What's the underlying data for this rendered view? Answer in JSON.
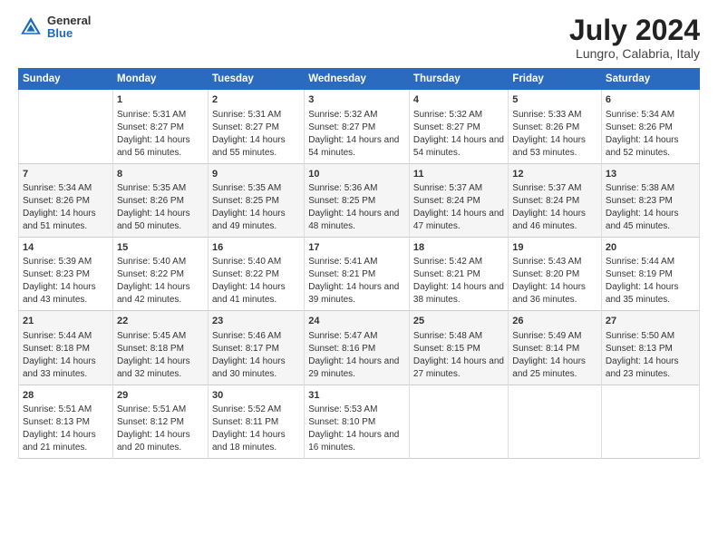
{
  "header": {
    "logo_general": "General",
    "logo_blue": "Blue",
    "title": "July 2024",
    "subtitle": "Lungro, Calabria, Italy"
  },
  "calendar": {
    "days_of_week": [
      "Sunday",
      "Monday",
      "Tuesday",
      "Wednesday",
      "Thursday",
      "Friday",
      "Saturday"
    ],
    "weeks": [
      [
        {
          "day": "",
          "sunrise": "",
          "sunset": "",
          "daylight": ""
        },
        {
          "day": "1",
          "sunrise": "Sunrise: 5:31 AM",
          "sunset": "Sunset: 8:27 PM",
          "daylight": "Daylight: 14 hours and 56 minutes."
        },
        {
          "day": "2",
          "sunrise": "Sunrise: 5:31 AM",
          "sunset": "Sunset: 8:27 PM",
          "daylight": "Daylight: 14 hours and 55 minutes."
        },
        {
          "day": "3",
          "sunrise": "Sunrise: 5:32 AM",
          "sunset": "Sunset: 8:27 PM",
          "daylight": "Daylight: 14 hours and 54 minutes."
        },
        {
          "day": "4",
          "sunrise": "Sunrise: 5:32 AM",
          "sunset": "Sunset: 8:27 PM",
          "daylight": "Daylight: 14 hours and 54 minutes."
        },
        {
          "day": "5",
          "sunrise": "Sunrise: 5:33 AM",
          "sunset": "Sunset: 8:26 PM",
          "daylight": "Daylight: 14 hours and 53 minutes."
        },
        {
          "day": "6",
          "sunrise": "Sunrise: 5:34 AM",
          "sunset": "Sunset: 8:26 PM",
          "daylight": "Daylight: 14 hours and 52 minutes."
        }
      ],
      [
        {
          "day": "7",
          "sunrise": "Sunrise: 5:34 AM",
          "sunset": "Sunset: 8:26 PM",
          "daylight": "Daylight: 14 hours and 51 minutes."
        },
        {
          "day": "8",
          "sunrise": "Sunrise: 5:35 AM",
          "sunset": "Sunset: 8:26 PM",
          "daylight": "Daylight: 14 hours and 50 minutes."
        },
        {
          "day": "9",
          "sunrise": "Sunrise: 5:35 AM",
          "sunset": "Sunset: 8:25 PM",
          "daylight": "Daylight: 14 hours and 49 minutes."
        },
        {
          "day": "10",
          "sunrise": "Sunrise: 5:36 AM",
          "sunset": "Sunset: 8:25 PM",
          "daylight": "Daylight: 14 hours and 48 minutes."
        },
        {
          "day": "11",
          "sunrise": "Sunrise: 5:37 AM",
          "sunset": "Sunset: 8:24 PM",
          "daylight": "Daylight: 14 hours and 47 minutes."
        },
        {
          "day": "12",
          "sunrise": "Sunrise: 5:37 AM",
          "sunset": "Sunset: 8:24 PM",
          "daylight": "Daylight: 14 hours and 46 minutes."
        },
        {
          "day": "13",
          "sunrise": "Sunrise: 5:38 AM",
          "sunset": "Sunset: 8:23 PM",
          "daylight": "Daylight: 14 hours and 45 minutes."
        }
      ],
      [
        {
          "day": "14",
          "sunrise": "Sunrise: 5:39 AM",
          "sunset": "Sunset: 8:23 PM",
          "daylight": "Daylight: 14 hours and 43 minutes."
        },
        {
          "day": "15",
          "sunrise": "Sunrise: 5:40 AM",
          "sunset": "Sunset: 8:22 PM",
          "daylight": "Daylight: 14 hours and 42 minutes."
        },
        {
          "day": "16",
          "sunrise": "Sunrise: 5:40 AM",
          "sunset": "Sunset: 8:22 PM",
          "daylight": "Daylight: 14 hours and 41 minutes."
        },
        {
          "day": "17",
          "sunrise": "Sunrise: 5:41 AM",
          "sunset": "Sunset: 8:21 PM",
          "daylight": "Daylight: 14 hours and 39 minutes."
        },
        {
          "day": "18",
          "sunrise": "Sunrise: 5:42 AM",
          "sunset": "Sunset: 8:21 PM",
          "daylight": "Daylight: 14 hours and 38 minutes."
        },
        {
          "day": "19",
          "sunrise": "Sunrise: 5:43 AM",
          "sunset": "Sunset: 8:20 PM",
          "daylight": "Daylight: 14 hours and 36 minutes."
        },
        {
          "day": "20",
          "sunrise": "Sunrise: 5:44 AM",
          "sunset": "Sunset: 8:19 PM",
          "daylight": "Daylight: 14 hours and 35 minutes."
        }
      ],
      [
        {
          "day": "21",
          "sunrise": "Sunrise: 5:44 AM",
          "sunset": "Sunset: 8:18 PM",
          "daylight": "Daylight: 14 hours and 33 minutes."
        },
        {
          "day": "22",
          "sunrise": "Sunrise: 5:45 AM",
          "sunset": "Sunset: 8:18 PM",
          "daylight": "Daylight: 14 hours and 32 minutes."
        },
        {
          "day": "23",
          "sunrise": "Sunrise: 5:46 AM",
          "sunset": "Sunset: 8:17 PM",
          "daylight": "Daylight: 14 hours and 30 minutes."
        },
        {
          "day": "24",
          "sunrise": "Sunrise: 5:47 AM",
          "sunset": "Sunset: 8:16 PM",
          "daylight": "Daylight: 14 hours and 29 minutes."
        },
        {
          "day": "25",
          "sunrise": "Sunrise: 5:48 AM",
          "sunset": "Sunset: 8:15 PM",
          "daylight": "Daylight: 14 hours and 27 minutes."
        },
        {
          "day": "26",
          "sunrise": "Sunrise: 5:49 AM",
          "sunset": "Sunset: 8:14 PM",
          "daylight": "Daylight: 14 hours and 25 minutes."
        },
        {
          "day": "27",
          "sunrise": "Sunrise: 5:50 AM",
          "sunset": "Sunset: 8:13 PM",
          "daylight": "Daylight: 14 hours and 23 minutes."
        }
      ],
      [
        {
          "day": "28",
          "sunrise": "Sunrise: 5:51 AM",
          "sunset": "Sunset: 8:13 PM",
          "daylight": "Daylight: 14 hours and 21 minutes."
        },
        {
          "day": "29",
          "sunrise": "Sunrise: 5:51 AM",
          "sunset": "Sunset: 8:12 PM",
          "daylight": "Daylight: 14 hours and 20 minutes."
        },
        {
          "day": "30",
          "sunrise": "Sunrise: 5:52 AM",
          "sunset": "Sunset: 8:11 PM",
          "daylight": "Daylight: 14 hours and 18 minutes."
        },
        {
          "day": "31",
          "sunrise": "Sunrise: 5:53 AM",
          "sunset": "Sunset: 8:10 PM",
          "daylight": "Daylight: 14 hours and 16 minutes."
        },
        {
          "day": "",
          "sunrise": "",
          "sunset": "",
          "daylight": ""
        },
        {
          "day": "",
          "sunrise": "",
          "sunset": "",
          "daylight": ""
        },
        {
          "day": "",
          "sunrise": "",
          "sunset": "",
          "daylight": ""
        }
      ]
    ]
  }
}
